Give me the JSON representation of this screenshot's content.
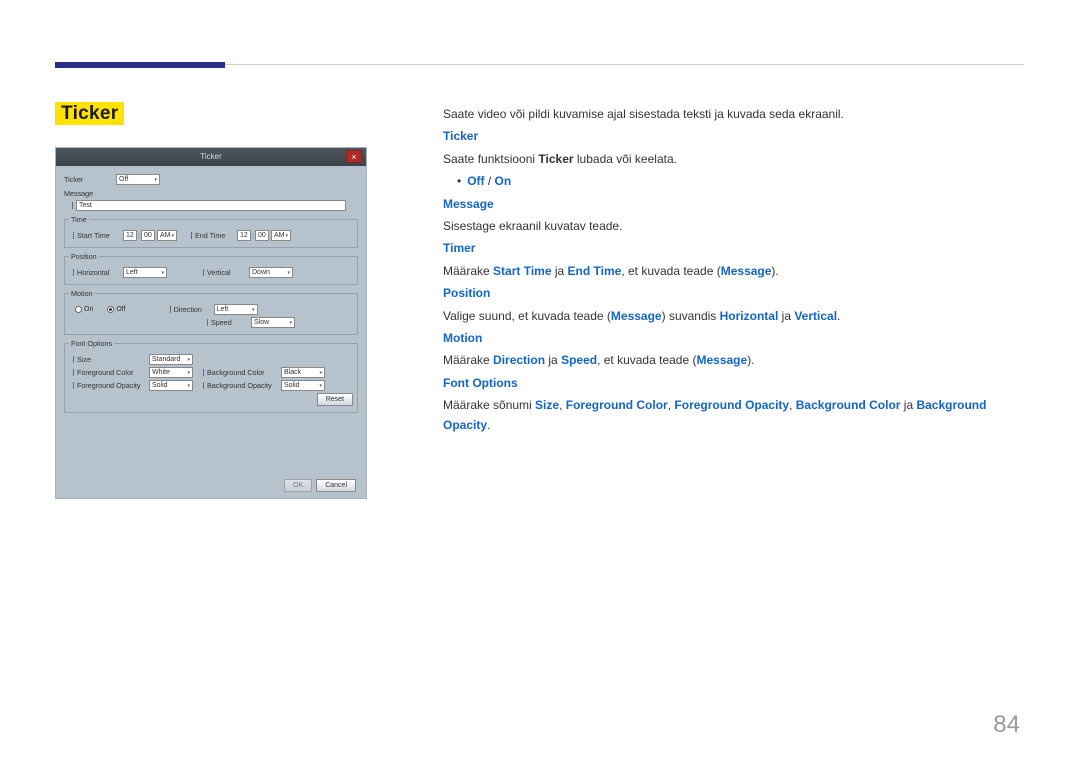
{
  "page_number": "84",
  "title": "Ticker",
  "panel": {
    "title": "Ticker",
    "close": "×",
    "ticker_label": "Ticker",
    "ticker_value": "Off",
    "message_label": "Message",
    "message_value": "Test",
    "time_legend": "Time",
    "start_label": "Start Time",
    "start_h": "12",
    "start_m": "00",
    "start_ampm": "AM",
    "end_label": "End Time",
    "end_h": "12",
    "end_m": "00",
    "end_ampm": "AM",
    "position_legend": "Position",
    "horizontal_label": "Horizontal",
    "horizontal_value": "Left",
    "vertical_label": "Vertical",
    "vertical_value": "Down",
    "motion_legend": "Motion",
    "on_label": "On",
    "off_label": "Off",
    "direction_label": "Direction",
    "direction_value": "Left",
    "speed_label": "Speed",
    "speed_value": "Slow",
    "font_legend": "Font Options",
    "size_label": "Size",
    "size_value": "Standard",
    "fgcolor_label": "Foreground Color",
    "fgcolor_value": "White",
    "fgopacity_label": "Foreground Opacity",
    "fgopacity_value": "Solid",
    "bgcolor_label": "Background Color",
    "bgcolor_value": "Black",
    "bgopacity_label": "Background Opacity",
    "bgopacity_value": "Solid",
    "reset": "Reset",
    "ok": "OK",
    "cancel": "Cancel"
  },
  "desc": {
    "intro": "Saate video või pildi kuvamise ajal sisestada teksti ja kuvada seda ekraanil.",
    "ticker_h": "Ticker",
    "ticker_t1": "Saate funktsiooni ",
    "ticker_t1b": "Ticker",
    "ticker_t1e": " lubada või keelata.",
    "off": "Off",
    "on": "On",
    "slash": " / ",
    "message_h": "Message",
    "message_t": "Sisestage ekraanil kuvatav teade.",
    "timer_h": "Timer",
    "timer_t1": "Määrake ",
    "timer_st": "Start Time",
    "timer_ja": " ja ",
    "timer_et": "End Time",
    "timer_mid": ", et kuvada teade (",
    "timer_msg": "Message",
    "timer_end": ").",
    "position_h": "Position",
    "position_t1": "Valige suund, et kuvada teade (",
    "position_msg": "Message",
    "position_t2": ") suvandis ",
    "position_hz": "Horizontal",
    "position_ja": " ja ",
    "position_vt": "Vertical",
    "position_end": ".",
    "motion_h": "Motion",
    "motion_t1": "Määrake ",
    "motion_dir": "Direction",
    "motion_ja": " ja ",
    "motion_sp": "Speed",
    "motion_mid": ", et kuvada teade (",
    "motion_msg": "Message",
    "motion_end": ").",
    "font_h": "Font Options",
    "font_t1": "Määrake sõnumi ",
    "font_size": "Size",
    "font_c": ", ",
    "font_fc": "Foreground Color",
    "font_fo": "Foreground Opacity",
    "font_bc": "Background Color",
    "font_ja": " ja ",
    "font_bo": "Background Opacity",
    "font_end": "."
  }
}
